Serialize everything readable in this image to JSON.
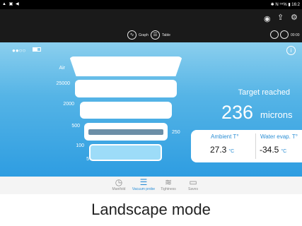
{
  "status": {
    "left": "▲ ▣ ◀",
    "right": "✱ N ⁵⁵% ▮ 16:2"
  },
  "modebar": {
    "graph_label": "Graph",
    "table_label": "Table",
    "timer": "00:00"
  },
  "gauge": {
    "labels": [
      "Air",
      "25000",
      "2000",
      "500",
      "100",
      "5"
    ],
    "marker_value": "250"
  },
  "status_message": "Target reached",
  "reading": {
    "value": "236",
    "unit": "microns"
  },
  "ambient": {
    "label": "Ambient T°",
    "value": "27.3",
    "unit": "°C"
  },
  "water": {
    "label": "Water evap. T°",
    "value": "-34.5",
    "unit": "°C"
  },
  "nav": [
    {
      "label": "Manifold"
    },
    {
      "label": "Vacuum probe"
    },
    {
      "label": "Tightness"
    },
    {
      "label": "Saves"
    }
  ],
  "caption": "Landscape mode",
  "colors": {
    "accent": "#2e9de1",
    "nav_active": "#2a8ed6"
  }
}
